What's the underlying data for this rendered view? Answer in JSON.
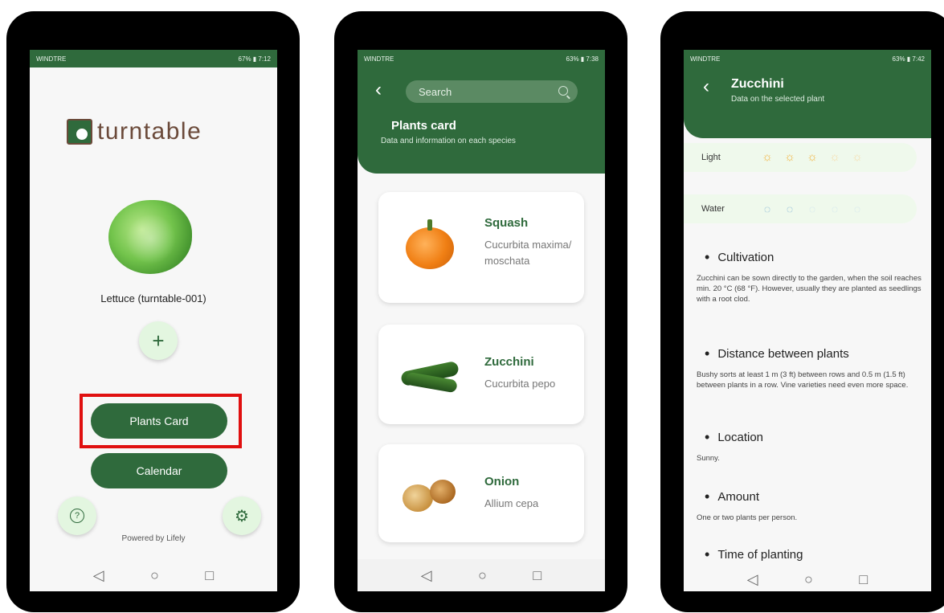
{
  "screen1": {
    "status": {
      "carrier": "WINDTRE",
      "battery": "67%",
      "time": "7:12"
    },
    "app_name": "turntable",
    "plant_label": "Lettuce (turntable-001)",
    "add_symbol": "+",
    "buttons": {
      "plants_card": "Plants Card",
      "calendar": "Calendar"
    },
    "help_symbol": "?",
    "powered": "Powered by Lifely"
  },
  "screen2": {
    "status": {
      "carrier": "WINDTRE",
      "battery": "63%",
      "time": "7:38"
    },
    "search_placeholder": "Search",
    "title": "Plants card",
    "subtitle": "Data and information on each species",
    "plants": [
      {
        "name": "Squash",
        "scientific": "Cucurbita maxima/ moschata"
      },
      {
        "name": "Zucchini",
        "scientific": "Cucurbita pepo"
      },
      {
        "name": "Onion",
        "scientific": "Allium cepa"
      }
    ]
  },
  "screen3": {
    "status": {
      "carrier": "WINDTRE",
      "battery": "63%",
      "time": "7:42"
    },
    "title": "Zucchini",
    "subtitle": "Data on the selected plant",
    "light": {
      "label": "Light",
      "level": 3,
      "max": 5
    },
    "water": {
      "label": "Water",
      "level": 2,
      "max": 5
    },
    "sections": [
      {
        "title": "Cultivation",
        "body": "Zucchini can be sown directly to the garden, when the soil reaches min. 20 °C (68 °F). However, usually they are planted as seedlings with a root clod."
      },
      {
        "title": "Distance between plants",
        "body": "Bushy sorts at least 1 m (3 ft) between rows and 0.5 m (1.5 ft) between plants in a row. Vine varieties need even more space."
      },
      {
        "title": "Location",
        "body": "Sunny."
      },
      {
        "title": "Amount",
        "body": "One or two plants per person."
      },
      {
        "title": "Time of planting",
        "body": ""
      }
    ]
  },
  "colors": {
    "primary_green": "#2f6a3c",
    "highlight_red": "#e01010"
  }
}
